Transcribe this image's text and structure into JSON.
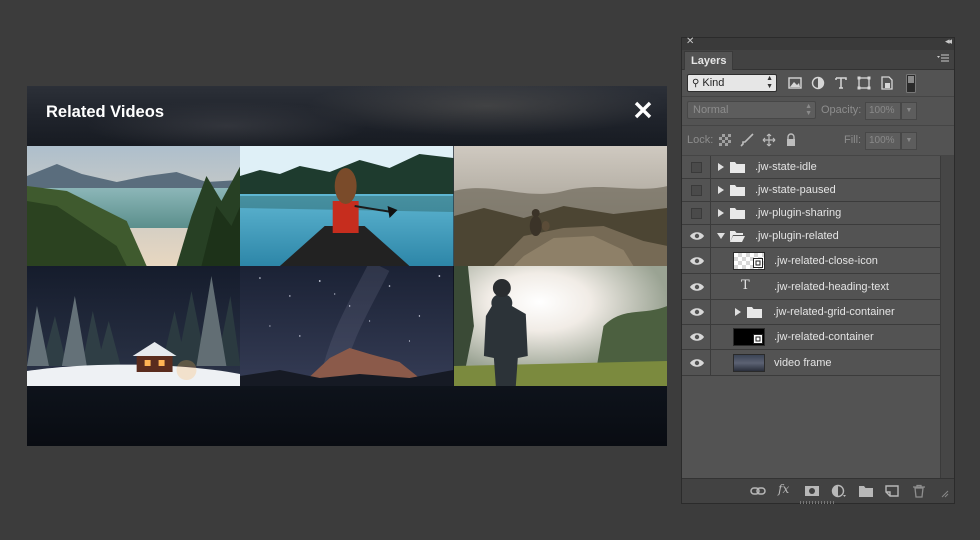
{
  "player": {
    "heading": "Related Videos",
    "close_icon": "close-icon",
    "thumbnails": [
      {
        "label": "mountain lake"
      },
      {
        "label": "woman in canoe"
      },
      {
        "label": "hiker on misty cliff"
      },
      {
        "label": "snowy cabin at night"
      },
      {
        "label": "milky way over mountains"
      },
      {
        "label": "man in sunlit forest"
      }
    ]
  },
  "panel": {
    "tab": "Layers",
    "filter_kind": "Kind",
    "blend_mode": "Normal",
    "opacity_label": "Opacity:",
    "opacity_value": "100%",
    "lock_label": "Lock:",
    "fill_label": "Fill:",
    "fill_value": "100%",
    "layers": [
      {
        "name": ".jw-state-idle",
        "visible": false,
        "type": "group",
        "expanded": false
      },
      {
        "name": ".jw-state-paused",
        "visible": false,
        "type": "group",
        "expanded": false
      },
      {
        "name": ".jw-plugin-sharing",
        "visible": false,
        "type": "group",
        "expanded": false
      },
      {
        "name": ".jw-plugin-related",
        "visible": true,
        "type": "group",
        "expanded": true
      },
      {
        "name": ".jw-related-close-icon",
        "visible": true,
        "type": "smart-object"
      },
      {
        "name": ".jw-related-heading-text",
        "visible": true,
        "type": "text"
      },
      {
        "name": ".jw-related-grid-container",
        "visible": true,
        "type": "group",
        "expanded": false
      },
      {
        "name": ".jw-related-container",
        "visible": true,
        "type": "smart-object"
      },
      {
        "name": "video frame",
        "visible": true,
        "type": "image"
      }
    ],
    "footer_icons": [
      "link-icon",
      "fx-icon",
      "mask-icon",
      "adjustment-icon",
      "new-group-icon",
      "new-layer-icon",
      "trash-icon"
    ]
  }
}
